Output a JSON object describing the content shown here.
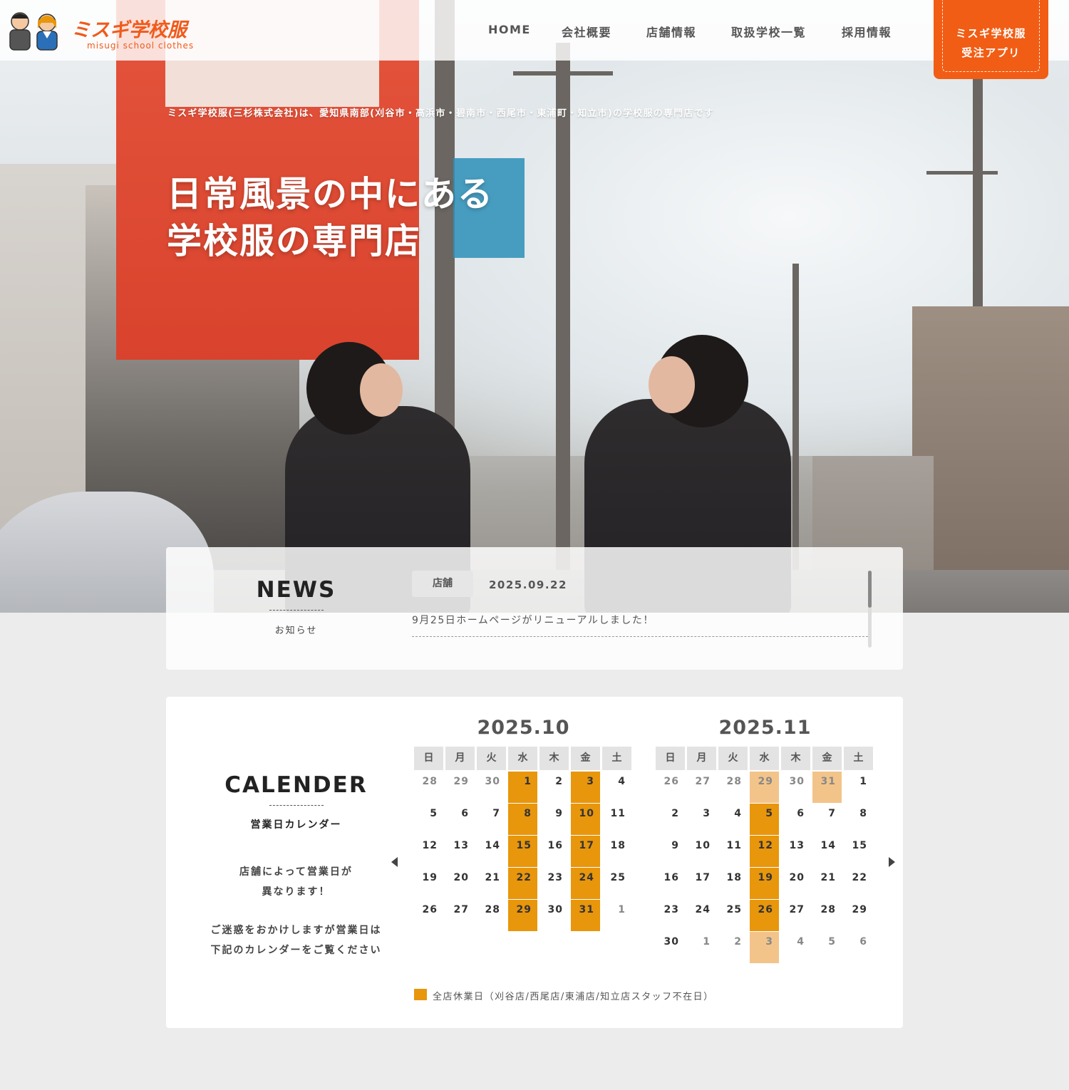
{
  "header": {
    "logo_text": "ミスギ学校服",
    "logo_sub": "misugi school clothes",
    "nav": [
      "HOME",
      "会社概要",
      "店舗情報",
      "取扱学校一覧",
      "採用情報"
    ],
    "app_button": {
      "line1": "ミスギ学校服",
      "line2": "受注アプリ"
    },
    "accent_color": "#f15d14"
  },
  "hero": {
    "subtitle": "ミスギ学校服(三杉株式会社)は、愛知県南部(刈谷市・高浜市・碧南市・西尾市・東浦町・知立市)の学校服の専門店です",
    "title_line1": "日常風景の中にある",
    "title_line2": "学校服の専門店"
  },
  "news": {
    "title": "NEWS",
    "subtitle": "お知らせ",
    "items": [
      {
        "category": "店舗",
        "date": "2025.09.22",
        "text": "9月25日ホームページがリニューアルしました！"
      }
    ]
  },
  "calendar": {
    "title": "CALENDER",
    "subtitle": "営業日カレンダー",
    "note1_line1": "店舗によって営業日が",
    "note1_line2": "異なります！",
    "note2_line1": "ご迷惑をおかけしますが営業日は",
    "note2_line2": "下記のカレンダーをご覧ください",
    "weekdays": [
      "日",
      "月",
      "火",
      "水",
      "木",
      "金",
      "土"
    ],
    "closed_color": "#e8960c",
    "legend": "全店休業日（刈谷店/西尾店/東浦店/知立店スタッフ不在日）",
    "months": [
      {
        "title": "2025.10",
        "weeks": [
          [
            {
              "d": "28",
              "o": true
            },
            {
              "d": "29",
              "o": true
            },
            {
              "d": "30",
              "o": true
            },
            {
              "d": "1",
              "c": true
            },
            {
              "d": "2"
            },
            {
              "d": "3",
              "c": true
            },
            {
              "d": "4"
            }
          ],
          [
            {
              "d": "5"
            },
            {
              "d": "6"
            },
            {
              "d": "7"
            },
            {
              "d": "8",
              "c": true
            },
            {
              "d": "9"
            },
            {
              "d": "10",
              "c": true
            },
            {
              "d": "11"
            }
          ],
          [
            {
              "d": "12"
            },
            {
              "d": "13"
            },
            {
              "d": "14"
            },
            {
              "d": "15",
              "c": true
            },
            {
              "d": "16"
            },
            {
              "d": "17",
              "c": true
            },
            {
              "d": "18"
            }
          ],
          [
            {
              "d": "19"
            },
            {
              "d": "20"
            },
            {
              "d": "21"
            },
            {
              "d": "22",
              "c": true
            },
            {
              "d": "23"
            },
            {
              "d": "24",
              "c": true
            },
            {
              "d": "25"
            }
          ],
          [
            {
              "d": "26"
            },
            {
              "d": "27"
            },
            {
              "d": "28"
            },
            {
              "d": "29",
              "c": true
            },
            {
              "d": "30"
            },
            {
              "d": "31",
              "c": true
            },
            {
              "d": "1",
              "o": true
            }
          ]
        ]
      },
      {
        "title": "2025.11",
        "weeks": [
          [
            {
              "d": "26",
              "o": true
            },
            {
              "d": "27",
              "o": true
            },
            {
              "d": "28",
              "o": true
            },
            {
              "d": "29",
              "o": true,
              "c": true
            },
            {
              "d": "30",
              "o": true
            },
            {
              "d": "31",
              "o": true,
              "c": true
            },
            {
              "d": "1"
            }
          ],
          [
            {
              "d": "2"
            },
            {
              "d": "3"
            },
            {
              "d": "4"
            },
            {
              "d": "5",
              "c": true
            },
            {
              "d": "6"
            },
            {
              "d": "7"
            },
            {
              "d": "8"
            }
          ],
          [
            {
              "d": "9"
            },
            {
              "d": "10"
            },
            {
              "d": "11"
            },
            {
              "d": "12",
              "c": true
            },
            {
              "d": "13"
            },
            {
              "d": "14"
            },
            {
              "d": "15"
            }
          ],
          [
            {
              "d": "16"
            },
            {
              "d": "17"
            },
            {
              "d": "18"
            },
            {
              "d": "19",
              "c": true
            },
            {
              "d": "20"
            },
            {
              "d": "21"
            },
            {
              "d": "22"
            }
          ],
          [
            {
              "d": "23"
            },
            {
              "d": "24"
            },
            {
              "d": "25"
            },
            {
              "d": "26",
              "c": true
            },
            {
              "d": "27"
            },
            {
              "d": "28"
            },
            {
              "d": "29"
            }
          ],
          [
            {
              "d": "30"
            },
            {
              "d": "1",
              "o": true
            },
            {
              "d": "2",
              "o": true
            },
            {
              "d": "3",
              "o": true,
              "c": true
            },
            {
              "d": "4",
              "o": true
            },
            {
              "d": "5",
              "o": true
            },
            {
              "d": "6",
              "o": true
            }
          ]
        ]
      }
    ]
  }
}
